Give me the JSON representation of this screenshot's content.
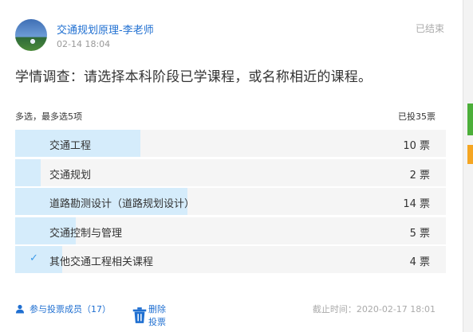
{
  "post": {
    "author": "交通规划原理-李老师",
    "date": "02-14 18:04",
    "status": "已结束",
    "question": "学情调查：请选择本科阶段已学课程，或名称相近的课程。",
    "mode_label": "多选，最多选5项",
    "total_label": "已投35票"
  },
  "options": [
    {
      "label": "交通工程",
      "count_label": "10 票",
      "votes": 10,
      "fraction": 0.29,
      "selected": false
    },
    {
      "label": "交通规划",
      "count_label": "2 票",
      "votes": 2,
      "fraction": 0.06,
      "selected": false
    },
    {
      "label": "道路勘测设计（道路规划设计）",
      "count_label": "14 票",
      "votes": 14,
      "fraction": 0.4,
      "selected": false
    },
    {
      "label": "交通控制与管理",
      "count_label": "5 票",
      "votes": 5,
      "fraction": 0.14,
      "selected": false
    },
    {
      "label": "其他交通工程相关课程",
      "count_label": "4 票",
      "votes": 4,
      "fraction": 0.11,
      "selected": true
    }
  ],
  "footer": {
    "members_label": "参与投票成员（17）",
    "delete_label": "删除投票",
    "deadline": "截止时间：2020-02-17 18:01"
  },
  "icons": {
    "selected_check": "checkmark-icon",
    "members": "user-icon",
    "delete": "trash-icon"
  },
  "colors": {
    "accent": "#1f6fd1",
    "bar_fill": "#d5ecfb",
    "check": "#3d9be9"
  }
}
